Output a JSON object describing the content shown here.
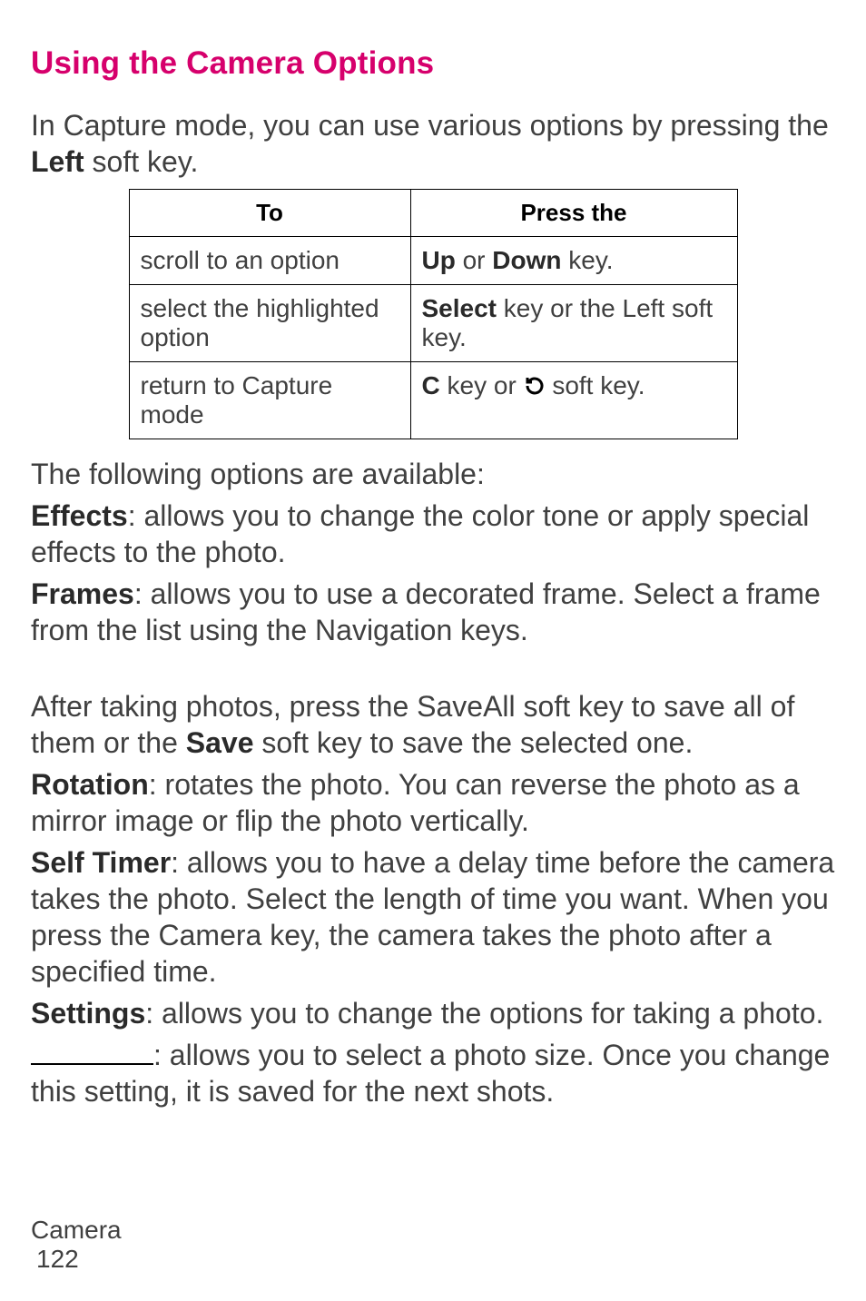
{
  "heading": "Using the Camera Options",
  "intro": {
    "prefix": "In Capture mode, you can use various options by pressing the ",
    "left": "Left",
    "suffix": " soft key."
  },
  "table": {
    "header": {
      "to": "To",
      "press": "Press the"
    },
    "rows": [
      {
        "to": "scroll to an option",
        "press_parts": {
          "up": "Up",
          "mid": " or ",
          "down": "Down",
          "end": " key."
        }
      },
      {
        "to": "select the highlighted option",
        "press_parts": {
          "select": "Select",
          "end": " key or the Left soft key."
        }
      },
      {
        "to": "return to Capture mode",
        "press_parts": {
          "c": "C",
          "mid": " key or ",
          "end": " soft key."
        }
      }
    ]
  },
  "options_intro": "The following options are available:",
  "options": {
    "effects": {
      "label": "Effects",
      "text": ": allows you to change the color tone or apply special effects to the photo."
    },
    "frames": {
      "label": "Frames",
      "text": ": allows you to use a decorated frame. Select a frame from the list using the Navigation keys."
    }
  },
  "after_photos": {
    "prefix": "After taking photos, press the SaveAll soft key to save all of them or the ",
    "save": "Save",
    "suffix": " soft key to save the selected one."
  },
  "options2": {
    "rotation": {
      "label": "Rotation",
      "text": ": rotates the photo. You can reverse the photo as a mirror image or flip the photo vertically."
    },
    "selftimer": {
      "label": "Self Timer",
      "text": ": allows you to have a delay time before the camera takes the photo. Select the length of time you want. When you press the Camera key, the camera takes the photo after a specified time."
    },
    "settings": {
      "label": "Settings",
      "text": ": allows you to change the options for taking a photo."
    },
    "blankline": {
      "text": ": allows you to select a photo size. Once you change this setting, it is saved for the next shots."
    }
  },
  "footer": {
    "section": "Camera",
    "page": "122"
  },
  "icon_names": {
    "refresh": "refresh-icon"
  }
}
